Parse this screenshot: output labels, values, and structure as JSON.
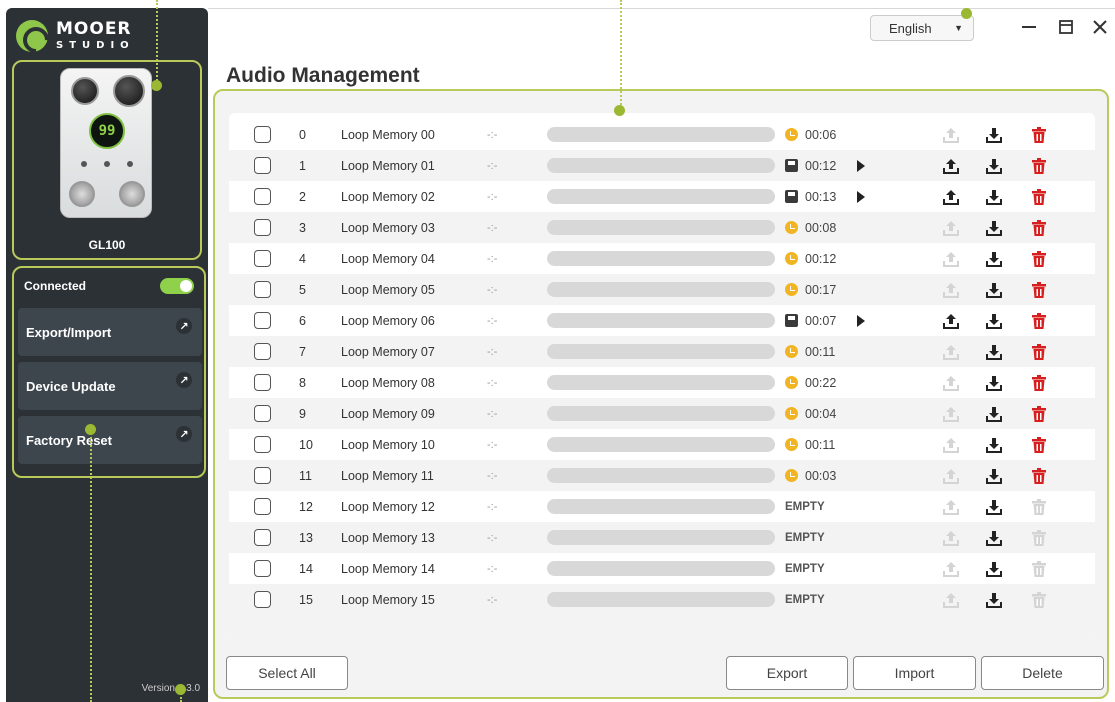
{
  "app": {
    "logo_brand": "MOOER",
    "logo_sub": "STUDIO",
    "device_screen": "99",
    "device_name": "GL100",
    "version": "Version 1.3.0"
  },
  "sidebar": {
    "connection_label": "Connected",
    "connected": true,
    "buttons": [
      {
        "label": "Export/Import"
      },
      {
        "label": "Device Update"
      },
      {
        "label": "Factory Reset"
      }
    ]
  },
  "header": {
    "language": "English",
    "title": "Audio Management"
  },
  "rows": [
    {
      "num": "0",
      "name": "Loop Memory 00",
      "bpm": "-:-",
      "status": "clock",
      "time": "00:06",
      "play": false,
      "upload": false,
      "delete": true
    },
    {
      "num": "1",
      "name": "Loop Memory 01",
      "bpm": "-:-",
      "status": "disk",
      "time": "00:12",
      "play": true,
      "upload": true,
      "delete": true
    },
    {
      "num": "2",
      "name": "Loop Memory 02",
      "bpm": "-:-",
      "status": "disk",
      "time": "00:13",
      "play": true,
      "upload": true,
      "delete": true
    },
    {
      "num": "3",
      "name": "Loop Memory 03",
      "bpm": "-:-",
      "status": "clock",
      "time": "00:08",
      "play": false,
      "upload": false,
      "delete": true
    },
    {
      "num": "4",
      "name": "Loop Memory 04",
      "bpm": "-:-",
      "status": "clock",
      "time": "00:12",
      "play": false,
      "upload": false,
      "delete": true
    },
    {
      "num": "5",
      "name": "Loop Memory 05",
      "bpm": "-:-",
      "status": "clock",
      "time": "00:17",
      "play": false,
      "upload": false,
      "delete": true
    },
    {
      "num": "6",
      "name": "Loop Memory 06",
      "bpm": "-:-",
      "status": "disk",
      "time": "00:07",
      "play": true,
      "upload": true,
      "delete": true
    },
    {
      "num": "7",
      "name": "Loop Memory 07",
      "bpm": "-:-",
      "status": "clock",
      "time": "00:11",
      "play": false,
      "upload": false,
      "delete": true
    },
    {
      "num": "8",
      "name": "Loop Memory 08",
      "bpm": "-:-",
      "status": "clock",
      "time": "00:22",
      "play": false,
      "upload": false,
      "delete": true
    },
    {
      "num": "9",
      "name": "Loop Memory 09",
      "bpm": "-:-",
      "status": "clock",
      "time": "00:04",
      "play": false,
      "upload": false,
      "delete": true
    },
    {
      "num": "10",
      "name": "Loop Memory 10",
      "bpm": "-:-",
      "status": "clock",
      "time": "00:11",
      "play": false,
      "upload": false,
      "delete": true
    },
    {
      "num": "11",
      "name": "Loop Memory 11",
      "bpm": "-:-",
      "status": "clock",
      "time": "00:03",
      "play": false,
      "upload": false,
      "delete": true
    },
    {
      "num": "12",
      "name": "Loop Memory 12",
      "bpm": "-:-",
      "status": "empty",
      "time": "EMPTY",
      "play": false,
      "upload": false,
      "delete": false
    },
    {
      "num": "13",
      "name": "Loop Memory 13",
      "bpm": "-:-",
      "status": "empty",
      "time": "EMPTY",
      "play": false,
      "upload": false,
      "delete": false
    },
    {
      "num": "14",
      "name": "Loop Memory 14",
      "bpm": "-:-",
      "status": "empty",
      "time": "EMPTY",
      "play": false,
      "upload": false,
      "delete": false
    },
    {
      "num": "15",
      "name": "Loop Memory 15",
      "bpm": "-:-",
      "status": "empty",
      "time": "EMPTY",
      "play": false,
      "upload": false,
      "delete": false
    }
  ],
  "footer": {
    "select_all": "Select All",
    "export": "Export",
    "import": "Import",
    "delete": "Delete"
  },
  "colors": {
    "accent_green": "#8fd14a",
    "guide_olive": "#b9c95a",
    "icon_active": "#222222",
    "icon_disabled": "#d4d4d4",
    "delete_red": "#d71f1f",
    "clock_yellow": "#f1b523"
  },
  "icons": {
    "upload": "upload-icon",
    "download": "download-icon",
    "delete": "trash-icon",
    "clock": "clock-icon",
    "disk": "save-disk-icon",
    "play": "play-icon"
  }
}
